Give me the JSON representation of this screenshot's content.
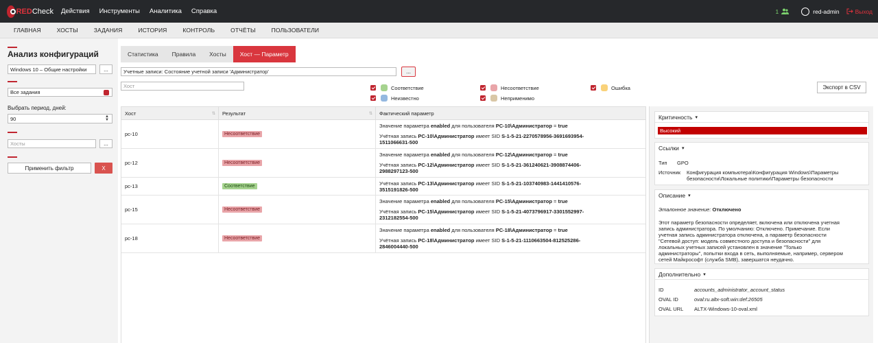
{
  "app": {
    "logo_red": "RED",
    "logo_check": "Check"
  },
  "top_menu": [
    "Действия",
    "Инструменты",
    "Аналитика",
    "Справка"
  ],
  "top_right": {
    "users_count": "1",
    "username": "red-admin",
    "logout": "Выход"
  },
  "nav": [
    "ГЛАВНАЯ",
    "ХОСТЫ",
    "ЗАДАНИЯ",
    "ИСТОРИЯ",
    "КОНТРОЛЬ",
    "ОТЧЁТЫ",
    "ПОЛЬЗОВАТЕЛИ"
  ],
  "sidebar": {
    "title": "Анализ конфигураций",
    "config_value": "Windows 10 – Общие настройки",
    "dots": "...",
    "tasks_value": "Все задания",
    "period_label": "Выбрать период, дней:",
    "period_value": "90",
    "hosts_placeholder": "Хосты",
    "apply_label": "Применить фильтр",
    "clear_label": "X"
  },
  "tabs": [
    "Статистика",
    "Правила",
    "Хосты",
    "Хост — Параметр"
  ],
  "param_field": "Учетные записи: Состояние учетной записи 'Администратор'",
  "host_placeholder": "Хост",
  "filters": [
    {
      "label": "Соответствие",
      "color": "#a6d38f"
    },
    {
      "label": "Несоответствие",
      "color": "#e9a5a9"
    },
    {
      "label": "Ошибка",
      "color": "#f9d27a"
    },
    {
      "label": "Неизвестно",
      "color": "#94b8e0"
    },
    {
      "label": "Неприменимо",
      "color": "#d9c7a6"
    }
  ],
  "export_label": "Экспорт в CSV",
  "table": {
    "headers": [
      "Хост",
      "Результат",
      "Фактический параметр"
    ],
    "rows": [
      {
        "host": "pc-10",
        "result": "Несоответствие",
        "status": "bad",
        "l1a": "Значение параметра ",
        "l1b": "enabled",
        "l1c": " для пользователя ",
        "l1d": "PC-10\\Администратор",
        "l1e": " = ",
        "l1f": "true",
        "l2a": "Учётная запись ",
        "l2b": "PC-10\\Администратор",
        "l2c": " имеет SID ",
        "l2d": "S-1-5-21-2270578956-3691693954-",
        "l3": "1511066631-500"
      },
      {
        "host": "pc-12",
        "result": "Несоответствие",
        "status": "bad",
        "l1a": "Значение параметра ",
        "l1b": "enabled",
        "l1c": " для пользователя ",
        "l1d": "PC-12\\Администратор",
        "l1e": " = ",
        "l1f": "true",
        "l2a": "Учётная запись ",
        "l2b": "PC-12\\Администратор",
        "l2c": " имеет SID ",
        "l2d": "S-1-5-21-361240621-3908874406-",
        "l3": "2988297123-500"
      },
      {
        "host": "pc-13",
        "result": "Соответствие",
        "status": "good",
        "l2a": "Учётная запись ",
        "l2b": "PC-13\\Администратор",
        "l2c": " имеет SID ",
        "l2d": "S-1-5-21-103740983-1441410576-",
        "l3": "3515191826-500"
      },
      {
        "host": "pc-15",
        "result": "Несоответствие",
        "status": "bad",
        "l1a": "Значение параметра ",
        "l1b": "enabled",
        "l1c": " для пользователя ",
        "l1d": "PC-15\\Администратор",
        "l1e": " = ",
        "l1f": "true",
        "l2a": "Учётная запись ",
        "l2b": "PC-15\\Администратор",
        "l2c": " имеет SID ",
        "l2d": "S-1-5-21-4073796917-3301552997-",
        "l3": "2312182554-500"
      },
      {
        "host": "pc-18",
        "result": "Несоответствие",
        "status": "bad",
        "l1a": "Значение параметра ",
        "l1b": "enabled",
        "l1c": " для пользователя ",
        "l1d": "PC-18\\Администратор",
        "l1e": " = ",
        "l1f": "true",
        "l2a": "Учётная запись ",
        "l2b": "PC-18\\Администратор",
        "l2c": " имеет SID ",
        "l2d": "S-1-5-21-1110663504-812525286-",
        "l3": "2846004440-500"
      }
    ]
  },
  "right": {
    "criticality_header": "Критичность",
    "criticality_value": "Высокий",
    "links_header": "Ссылки",
    "type_key": "Тип",
    "type_val": "GPO",
    "source_key": "Источник",
    "source_val1": "Конфигурация компьютера\\Конфигурация Windows\\Параметры",
    "source_val2": "безопасности\\Локальные политики\\Параметры безопасности",
    "desc_header": "Описание",
    "ref_label": "Эталонное значение:",
    "ref_value": "Отключено",
    "desc_lines": [
      "Этот параметр безопасности определяет, включена или отключена учетная",
      "запись администратора. По умолчанию: Отключено. Примечание. Если",
      "учетная запись администратора отключена, а параметр безопасности",
      "\"Сетевой доступ: модель совместного доступа и безопасности\" для",
      "локальных учетных записей установлен в значение \"Только",
      "администраторы\", попытки входа в сеть, выполняемые, например, сервером",
      "сетей Майкрософт (служба SMB), завершатся неудачно."
    ],
    "extra_header": "Дополнительно",
    "id_key": "ID",
    "id_val": "accounts_administrator_account_status",
    "oval_key": "OVAL ID",
    "oval_val": "oval:ru.altx-soft.win:def:26505",
    "url_key": "OVAL URL",
    "url_val": "ALTX-Windows-10-oval.xml"
  }
}
